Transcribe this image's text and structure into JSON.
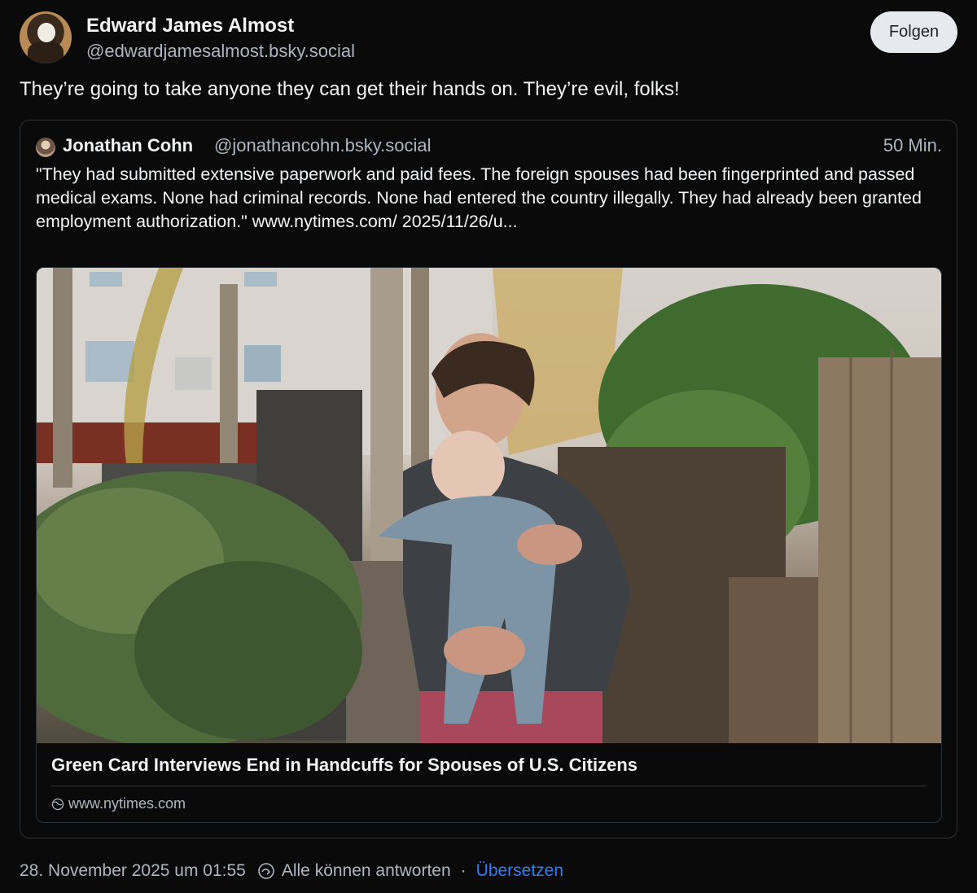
{
  "post": {
    "author_name": "Edward James Almost",
    "author_handle": "@edwardjamesalmost.bsky.social",
    "follow_label": "Folgen",
    "text": "They’re going to take anyone they can get their hands on. They’re evil, folks!"
  },
  "quote": {
    "author_name": "Jonathan Cohn",
    "author_handle": "@jonathancohn.bsky.social",
    "time": "50 Min.",
    "text": "\"They had submitted extensive paperwork and paid fees. The foreign spouses had been fingerprinted and passed medical exams. None had  criminal records. None had entered the country illegally. They had  already been granted employment authorization.\" www.nytimes.com/ 2025/11/26/u...",
    "card": {
      "title": "Green Card Interviews End in Handcuffs for Spouses of U.S. Citizens",
      "domain": "www.nytimes.com"
    }
  },
  "footer": {
    "timestamp": "28. November 2025 um 01:55",
    "reply_setting": "Alle können antworten",
    "separator": "·",
    "translate_label": "Übersetzen"
  },
  "colors": {
    "background": "#0a0a0a",
    "link": "#2f7ff5",
    "follow_button": "#e6e9ee"
  }
}
